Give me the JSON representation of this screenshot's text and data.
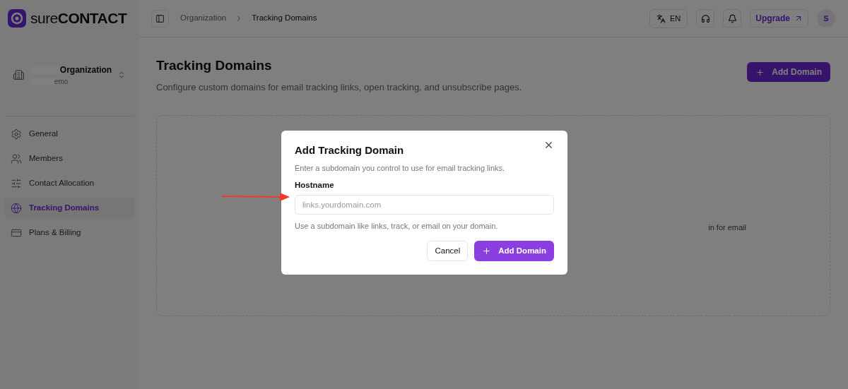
{
  "brand": {
    "prefix": "sure",
    "name": "CONTACT"
  },
  "organization": {
    "name": "Organization",
    "subtitle": "emo"
  },
  "sidebar": {
    "items": [
      {
        "label": "General",
        "selected": false
      },
      {
        "label": "Members",
        "selected": false
      },
      {
        "label": "Contact Allocation",
        "selected": false
      },
      {
        "label": "Tracking Domains",
        "selected": true
      },
      {
        "label": "Plans & Billing",
        "selected": false
      }
    ]
  },
  "breadcrumb": [
    "Organization",
    "Tracking Domains"
  ],
  "topbar": {
    "language": "EN",
    "upgrade": "Upgrade",
    "avatar": "S"
  },
  "page": {
    "title": "Tracking Domains",
    "description": "Configure custom domains for email tracking links, open tracking, and unsubscribe pages.",
    "add_button": "Add Domain",
    "empty_text": "in for email"
  },
  "dialog": {
    "title": "Add Tracking Domain",
    "description": "Enter a subdomain you control to use for email tracking links.",
    "field_label": "Hostname",
    "placeholder": "links.yourdomain.com",
    "hint": "Use a subdomain like links, track, or email on your domain.",
    "cancel": "Cancel",
    "submit": "Add Domain"
  }
}
